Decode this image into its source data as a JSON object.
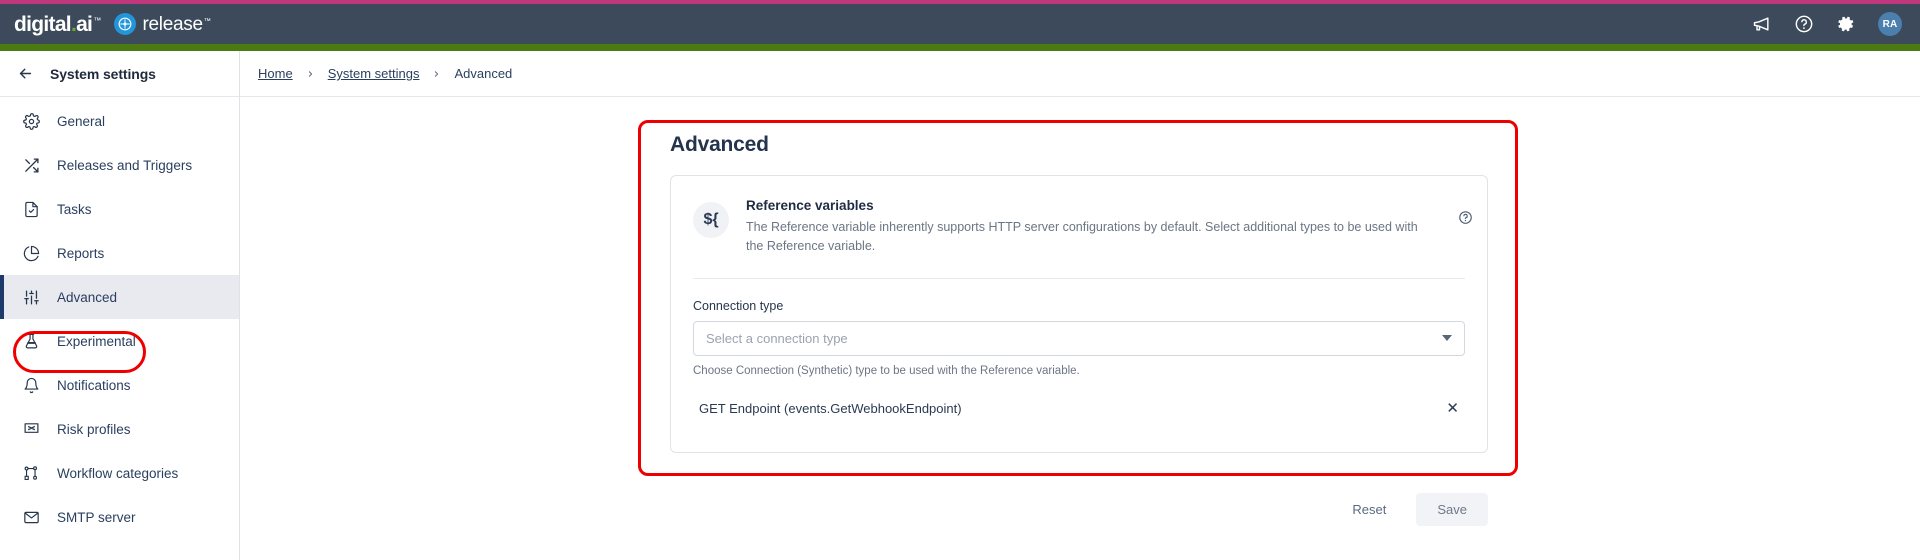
{
  "brand": {
    "company": "digital.ai",
    "product": "release",
    "trademark": "™"
  },
  "appbar": {
    "icons": [
      {
        "name": "megaphone-icon",
        "label": "Announcements"
      },
      {
        "name": "help-circle-icon",
        "label": "Help"
      },
      {
        "name": "gear-icon",
        "label": "Settings"
      }
    ],
    "avatar_initials": "RA"
  },
  "sidebar": {
    "back_label": "System settings",
    "items": [
      {
        "label": "General",
        "icon": "gear-icon"
      },
      {
        "label": "Releases and Triggers",
        "icon": "shuffle-icon"
      },
      {
        "label": "Tasks",
        "icon": "task-document-icon"
      },
      {
        "label": "Reports",
        "icon": "pie-chart-icon"
      },
      {
        "label": "Advanced",
        "icon": "sliders-icon"
      },
      {
        "label": "Experimental",
        "icon": "flask-icon"
      },
      {
        "label": "Notifications",
        "icon": "bell-icon"
      },
      {
        "label": "Risk profiles",
        "icon": "risk-flag-icon"
      },
      {
        "label": "Workflow categories",
        "icon": "workflow-icon"
      },
      {
        "label": "SMTP server",
        "icon": "envelope-icon"
      }
    ],
    "active_index": 4
  },
  "breadcrumb": {
    "items": [
      "Home",
      "System settings",
      "Advanced"
    ],
    "separator": "›"
  },
  "main": {
    "title": "Advanced",
    "reference_variables": {
      "badge": "${",
      "title": "Reference variables",
      "description": "The Reference variable inherently supports HTTP server configurations by default. Select additional types to be used with the Reference variable.",
      "help_icon": "help-circle-icon"
    },
    "connection_type": {
      "label": "Connection type",
      "placeholder": "Select a connection type",
      "value": "",
      "hint": "Choose Connection (Synthetic) type to be used with the Reference variable."
    },
    "selected_items": [
      {
        "label": "GET Endpoint (events.GetWebhookEndpoint)",
        "remove_icon": "close-icon"
      }
    ],
    "actions": {
      "reset_label": "Reset",
      "save_label": "Save"
    }
  },
  "annotations": {
    "highlight_color": "#ef0000",
    "targets": [
      "sidebar-item-advanced",
      "advanced-panel"
    ]
  },
  "colors": {
    "header_bg": "#3d4a5c",
    "accent_top": "#c0377e",
    "accent_green": "#4b7a12",
    "brand_blue": "#2196d9",
    "brand_green": "#6aab2c",
    "active_nav_bar": "#1d3a6b"
  }
}
